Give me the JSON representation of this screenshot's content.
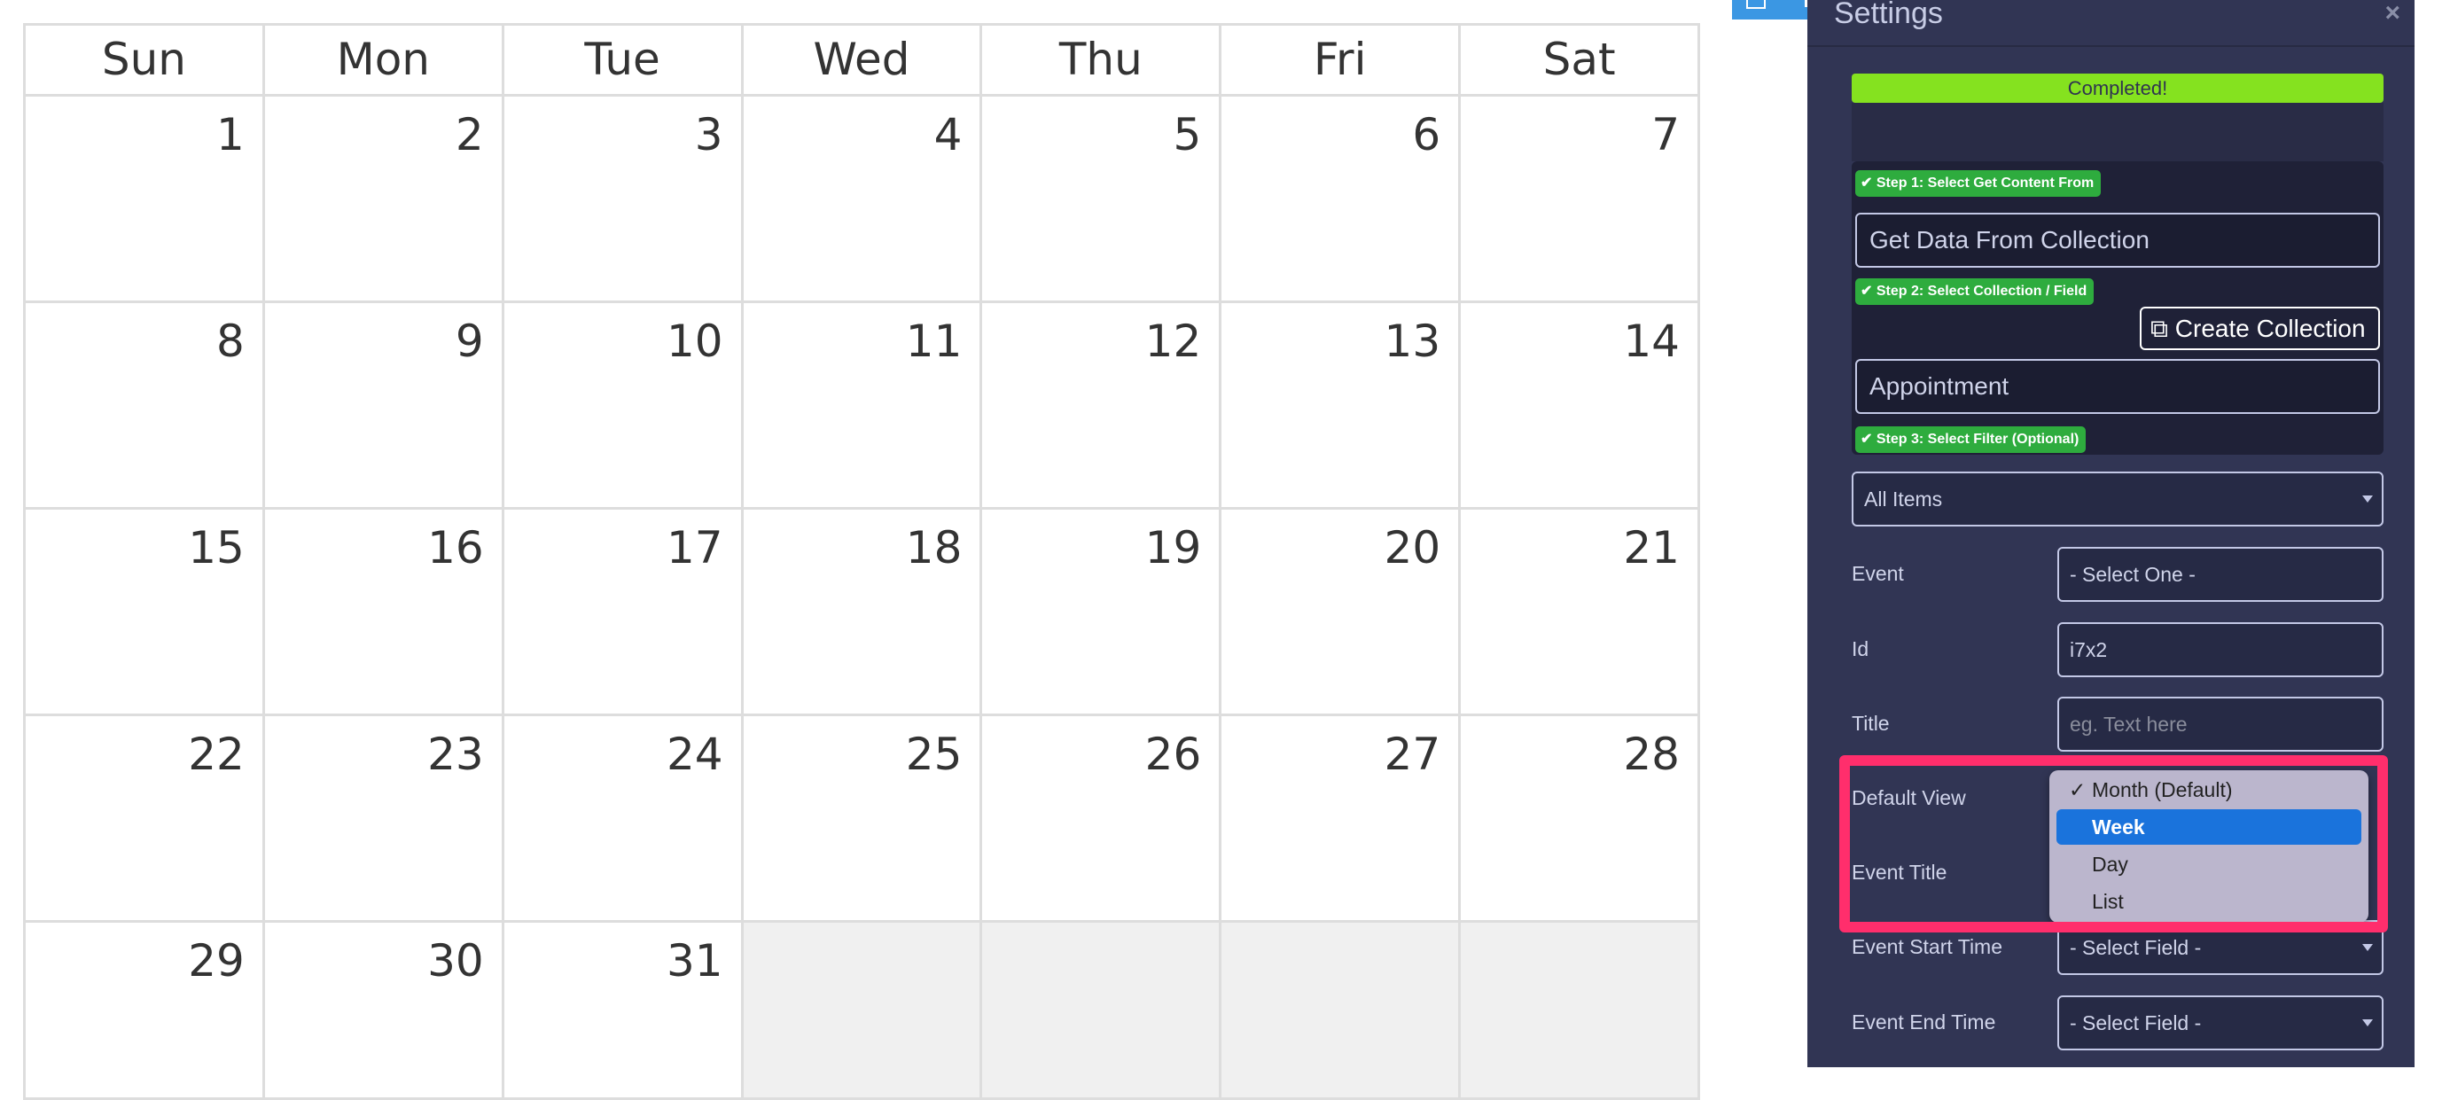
{
  "calendar": {
    "weekdays": [
      "Sun",
      "Mon",
      "Tue",
      "Wed",
      "Thu",
      "Fri",
      "Sat"
    ],
    "weeks": [
      [
        "1",
        "2",
        "3",
        "4",
        "5",
        "6",
        "7"
      ],
      [
        "8",
        "9",
        "10",
        "11",
        "12",
        "13",
        "14"
      ],
      [
        "15",
        "16",
        "17",
        "18",
        "19",
        "20",
        "21"
      ],
      [
        "22",
        "23",
        "24",
        "25",
        "26",
        "27",
        "28"
      ],
      [
        "29",
        "30",
        "31",
        "",
        "",
        "",
        ""
      ]
    ]
  },
  "settings": {
    "title": "Settings",
    "close": "×",
    "completed": "Completed!",
    "step1": "Step 1: Select Get Content From",
    "step1_value": "Get Data From Collection",
    "step2": "Step 2: Select Collection / Field",
    "create_collection": "Create Collection",
    "step2_value": "Appointment",
    "step3": "Step 3: Select Filter (Optional)",
    "filter_value": "All Items",
    "fields": {
      "event_label": "Event",
      "event_value": "- Select One -",
      "id_label": "Id",
      "id_value": "i7x2",
      "title_label": "Title",
      "title_placeholder": "eg. Text here",
      "default_view_label": "Default View",
      "event_title_label": "Event Title",
      "start_label": "Event Start Time",
      "start_value": "- Select Field -",
      "end_label": "Event End Time",
      "end_value": "- Select Field -"
    },
    "default_view_options": [
      {
        "label": "Month (Default)",
        "checked": true
      },
      {
        "label": "Week",
        "highlighted": true
      },
      {
        "label": "Day"
      },
      {
        "label": "List"
      }
    ],
    "colors": {
      "panel": "#313554",
      "completed": "#85e21f",
      "badge": "#2eac3e",
      "highlight": "#ff2e6c",
      "selected_option": "#1a73dc"
    }
  }
}
